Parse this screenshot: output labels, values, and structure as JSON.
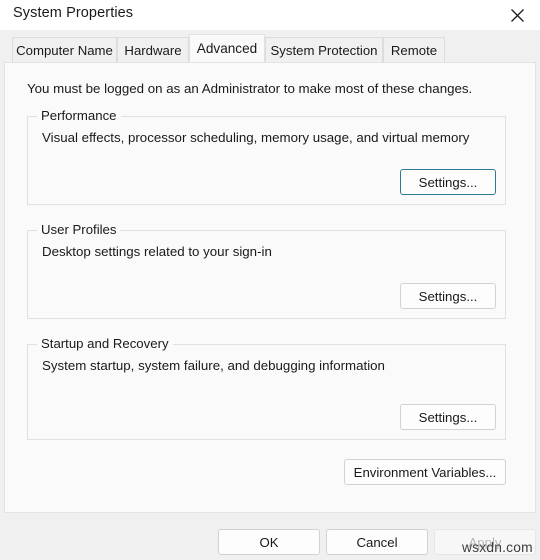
{
  "window": {
    "title": "System Properties",
    "close_icon": "close-icon"
  },
  "tabs": [
    {
      "label": "Computer Name",
      "selected": false
    },
    {
      "label": "Hardware",
      "selected": false
    },
    {
      "label": "Advanced",
      "selected": true
    },
    {
      "label": "System Protection",
      "selected": false
    },
    {
      "label": "Remote",
      "selected": false
    }
  ],
  "page": {
    "admin_note": "You must be logged on as an Administrator to make most of these changes.",
    "groups": [
      {
        "legend": "Performance",
        "description": "Visual effects, processor scheduling, memory usage, and virtual memory",
        "button_label": "Settings...",
        "button_focused": true
      },
      {
        "legend": "User Profiles",
        "description": "Desktop settings related to your sign-in",
        "button_label": "Settings...",
        "button_focused": false
      },
      {
        "legend": "Startup and Recovery",
        "description": "System startup, system failure, and debugging information",
        "button_label": "Settings...",
        "button_focused": false
      }
    ],
    "environment_variables_label": "Environment Variables..."
  },
  "footer": {
    "ok_label": "OK",
    "cancel_label": "Cancel",
    "apply_label": "Apply",
    "apply_disabled": true
  },
  "watermark": {
    "text": "wsxdn.com"
  },
  "colors": {
    "focus_border": "#2f7d94",
    "dialog_bg": "#f0f0f0",
    "page_bg": "#fafafa",
    "text": "#1a1a1a",
    "disabled_text": "#b6b6b6"
  }
}
